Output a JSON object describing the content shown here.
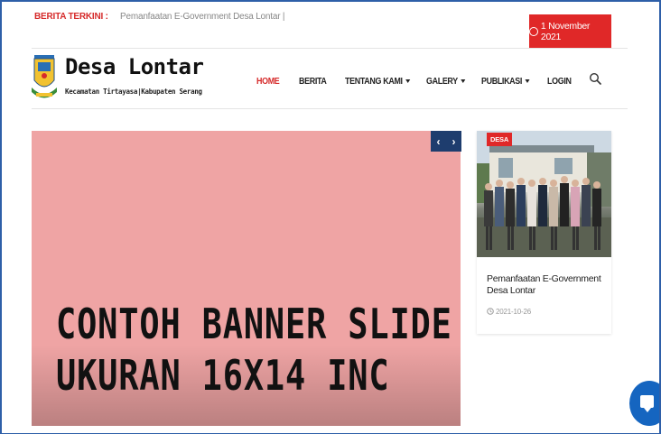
{
  "ticker": {
    "label": "BERITA TERKINI :",
    "headline": "Pemanfaatan E-Government Desa Lontar |",
    "date": "1 November 2021"
  },
  "site": {
    "title": "Desa Lontar",
    "subtitle": "Kecamatan Tirtayasa|Kabupaten Serang"
  },
  "nav": {
    "items": [
      {
        "label": "HOME",
        "active": true,
        "dropdown": false
      },
      {
        "label": "BERITA",
        "active": false,
        "dropdown": false
      },
      {
        "label": "TENTANG KAMI",
        "active": false,
        "dropdown": true
      },
      {
        "label": "GALERY",
        "active": false,
        "dropdown": true
      },
      {
        "label": "PUBLIKASI",
        "active": false,
        "dropdown": true
      },
      {
        "label": "LOGIN",
        "active": false,
        "dropdown": false
      }
    ],
    "search_icon": "search-icon"
  },
  "slider": {
    "banner_line_1": "CONTOH BANNER SLIDE",
    "banner_line_2": "UKURAN 16X14 INC",
    "prev": "‹",
    "next": "›",
    "background": "#efa4a4"
  },
  "card": {
    "tag": "DESA",
    "title": "Pemanfaatan E-Government Desa Lontar",
    "date": "2021-10-26"
  },
  "colors": {
    "accent": "#e02828",
    "nav_dark": "#1e3d6e",
    "chat": "#1565c0"
  }
}
